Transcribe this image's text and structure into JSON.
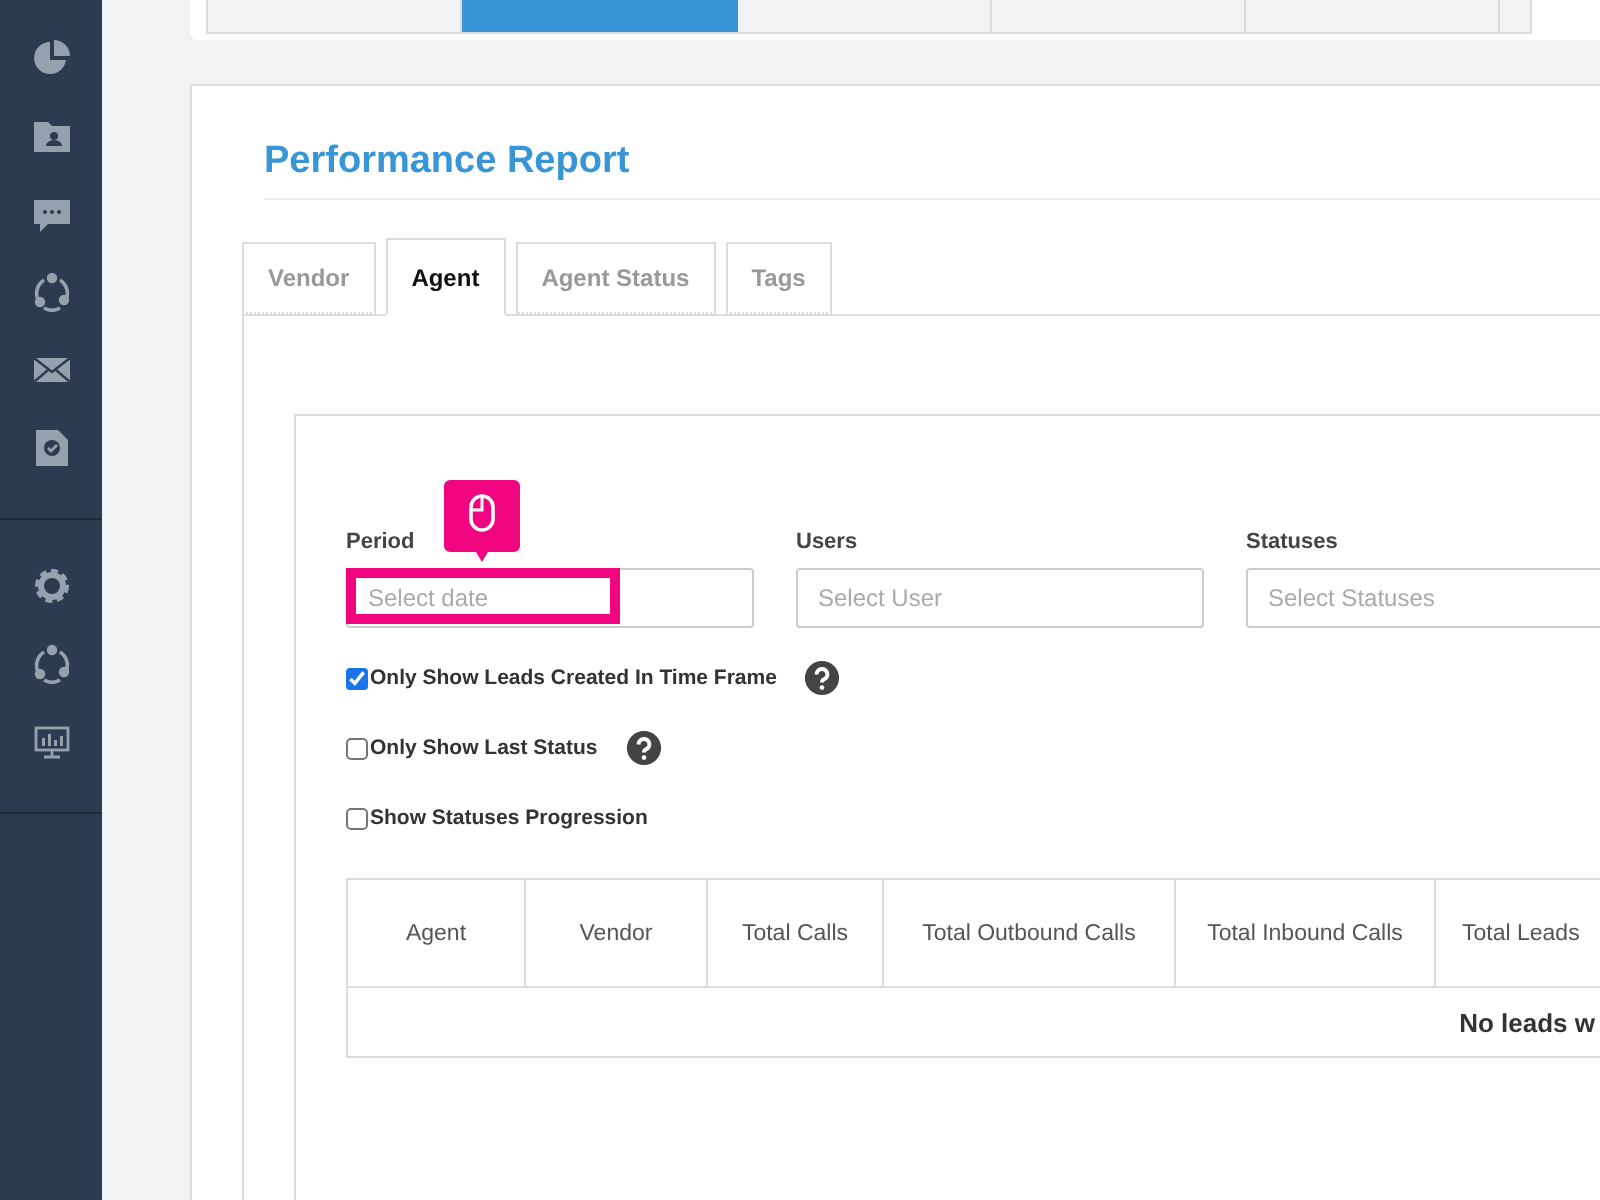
{
  "sidebar": {
    "items": [
      {
        "kind": "pie"
      },
      {
        "kind": "folder"
      },
      {
        "kind": "chat"
      },
      {
        "kind": "network"
      },
      {
        "kind": "mail"
      },
      {
        "kind": "doc"
      },
      {
        "kind": "divider"
      },
      {
        "kind": "gear"
      },
      {
        "kind": "network"
      },
      {
        "kind": "monitor"
      },
      {
        "kind": "divider"
      }
    ]
  },
  "top_bar": {
    "segments": [
      {
        "selected": false
      },
      {
        "selected": true
      },
      {
        "selected": false
      },
      {
        "selected": false
      },
      {
        "selected": false
      }
    ]
  },
  "title": "Performance Report",
  "tabs": [
    {
      "label": "Vendor",
      "selected": false
    },
    {
      "label": "Agent",
      "selected": true
    },
    {
      "label": "Agent Status",
      "selected": false
    },
    {
      "label": "Tags",
      "selected": false
    }
  ],
  "filters": [
    {
      "label": "Period",
      "placeholder": "Select date",
      "highlighted": true
    },
    {
      "label": "Users",
      "placeholder": "Select User",
      "highlighted": false
    },
    {
      "label": "Statuses",
      "placeholder": "Select Statuses",
      "highlighted": false
    }
  ],
  "options": [
    {
      "label": "Only Show Leads Created In Time Frame",
      "checked": true,
      "help": true
    },
    {
      "label": "Only Show Last Status",
      "checked": false,
      "help": true
    },
    {
      "label": "Show Statuses Progression",
      "checked": false,
      "help": false
    }
  ],
  "table": {
    "columns": [
      "Agent",
      "Vendor",
      "Total Calls",
      "Total Outbound Calls",
      "Total Inbound Calls",
      "Total Leads"
    ],
    "empty_message": "No leads w"
  }
}
